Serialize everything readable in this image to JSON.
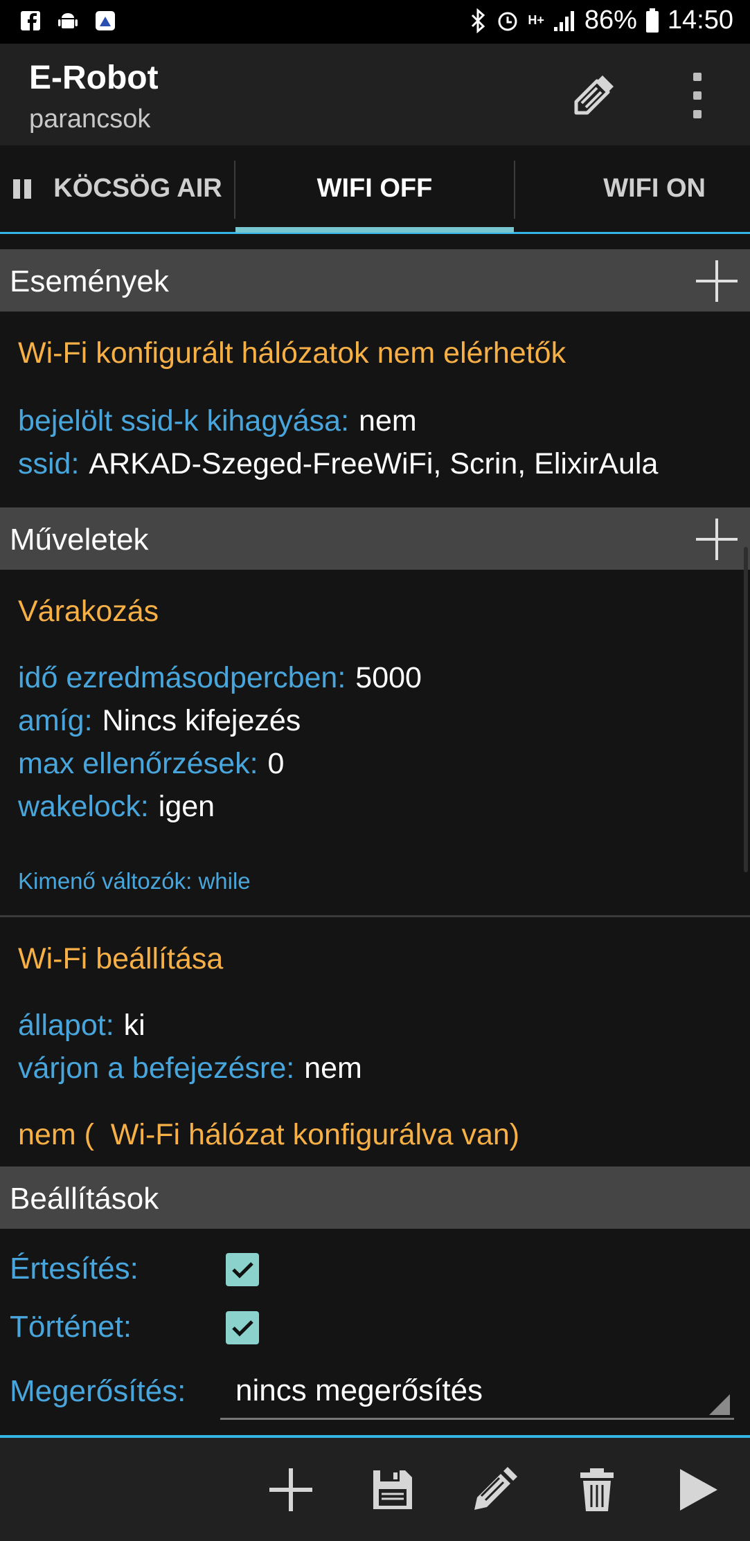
{
  "status_bar": {
    "battery": "86%",
    "time": "14:50",
    "network": "H+"
  },
  "app_bar": {
    "title": "E-Robot",
    "subtitle": "parancsok"
  },
  "tabs": [
    {
      "label": "KÖCSÖG AIR"
    },
    {
      "label": "WIFI OFF"
    },
    {
      "label": "WIFI ON"
    }
  ],
  "events": {
    "header": "Események",
    "trigger": {
      "title": "Wi-Fi konfigurált hálózatok nem elérhetők",
      "params": [
        {
          "key": "bejelölt ssid-k kihagyása:",
          "value": "nem"
        },
        {
          "key": "ssid:",
          "value": "ARKAD-Szeged-FreeWiFi, Scrin, ElixirAula"
        }
      ]
    }
  },
  "actions": {
    "header": "Műveletek",
    "items": [
      {
        "title": "Várakozás",
        "params": [
          {
            "key": "idő ezredmásodpercben:",
            "value": "5000"
          },
          {
            "key": "amíg:",
            "value": "Nincs kifejezés"
          },
          {
            "key": "max ellenőrzések:",
            "value": "0"
          },
          {
            "key": "wakelock:",
            "value": "igen"
          }
        ],
        "output_vars": "Kimenő változók: while"
      },
      {
        "title": "Wi-Fi beállítása",
        "params": [
          {
            "key": "állapot:",
            "value": "ki"
          },
          {
            "key": "várjon a befejezésre:",
            "value": "nem"
          }
        ],
        "condition": "nem (  Wi-Fi hálózat konfigurálva van)"
      }
    ]
  },
  "settings": {
    "header": "Beállítások",
    "notification_label": "Értesítés:",
    "notification_checked": true,
    "history_label": "Történet:",
    "history_checked": true,
    "confirm_label": "Megerősítés:",
    "confirm_value": "nincs megerősítés"
  },
  "bottom_bar": [
    "add-icon",
    "save-icon",
    "edit-icon",
    "delete-icon",
    "play-icon"
  ],
  "colors": {
    "accent": "#34b5e5",
    "title_orange": "#f7b046",
    "key_blue": "#48a6dc",
    "checkbox": "#8ad2cb"
  }
}
